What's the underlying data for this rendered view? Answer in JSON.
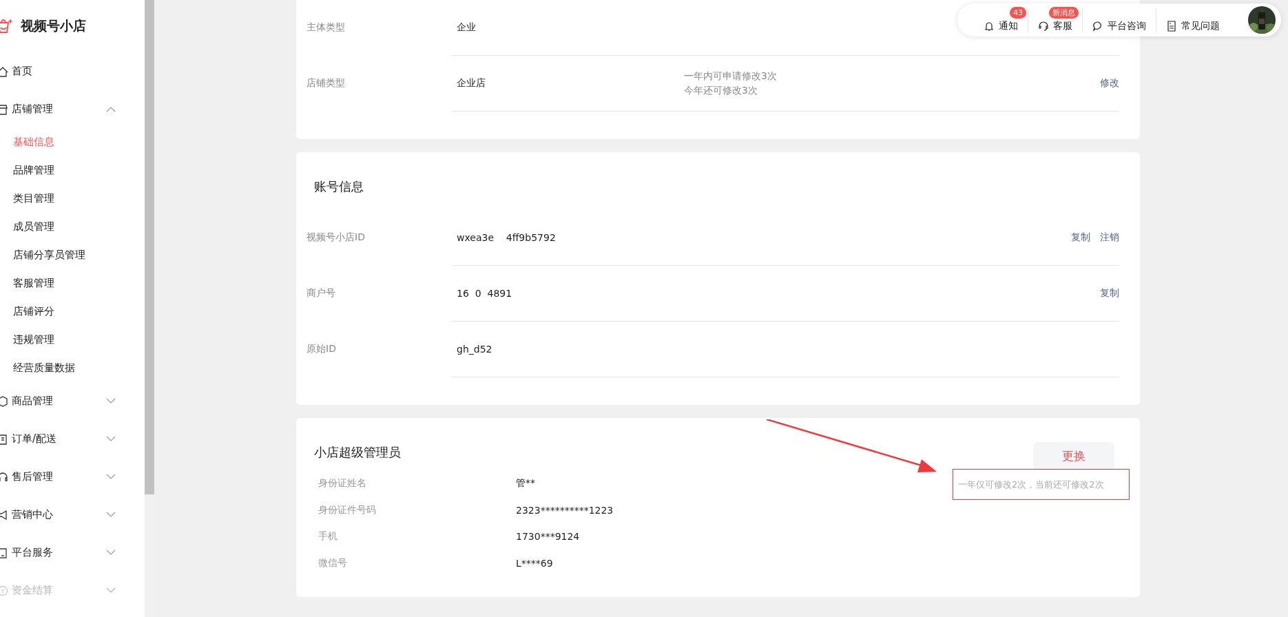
{
  "brand": {
    "name": "视频号小店"
  },
  "nav": [
    {
      "label": "首页",
      "expandable": false
    },
    {
      "label": "店铺管理",
      "expandable": true,
      "expanded": true,
      "children": [
        {
          "label": "基础信息",
          "selected": true
        },
        {
          "label": "品牌管理",
          "selected": false
        },
        {
          "label": "类目管理",
          "selected": false
        },
        {
          "label": "成员管理",
          "selected": false
        },
        {
          "label": "店铺分享员管理",
          "selected": false
        },
        {
          "label": "客服管理",
          "selected": false
        },
        {
          "label": "店铺评分",
          "selected": false
        },
        {
          "label": "违规管理",
          "selected": false
        },
        {
          "label": "经营质量数据",
          "selected": false
        }
      ]
    },
    {
      "label": "商品管理",
      "expandable": true,
      "expanded": false
    },
    {
      "label": "订单/配送",
      "expandable": true,
      "expanded": false
    },
    {
      "label": "售后管理",
      "expandable": true,
      "expanded": false
    },
    {
      "label": "营销中心",
      "expandable": true,
      "expanded": false
    },
    {
      "label": "平台服务",
      "expandable": true,
      "expanded": false
    },
    {
      "label": "资金结算",
      "expandable": true,
      "expanded": false
    }
  ],
  "topbar": {
    "items": [
      {
        "label": "通知",
        "badge": "43"
      },
      {
        "label": "客服",
        "badge": "新消息"
      },
      {
        "label": "平台咨询"
      },
      {
        "label": "常见问题"
      }
    ]
  },
  "cards": [
    {
      "rows": [
        {
          "label": "主体类型",
          "value": "企业"
        },
        {
          "label": "店铺类型",
          "value": "企业店",
          "note": [
            "一年内可申请修改3次",
            "今年还可修改3次"
          ],
          "actions": [
            "修改"
          ]
        }
      ]
    },
    {
      "title": "账号信息",
      "rows": [
        {
          "label": "视频号小店ID",
          "value": "wxea3e    4ff9b5792",
          "actions": [
            "复制",
            "注销"
          ]
        },
        {
          "label": "商户号",
          "value": "16  0  4891",
          "actions": [
            "复制"
          ]
        },
        {
          "label": "原始ID",
          "value": "gh_d52"
        }
      ]
    },
    {
      "title": "小店超级管理员",
      "kind": "compact",
      "button": "更换",
      "note": "一年仅可修改2次，当前还可修改2次",
      "rows": [
        {
          "label": "身份证姓名",
          "value": "管**"
        },
        {
          "label": "身份证件号码",
          "value": "2323**********1223"
        },
        {
          "label": "手机",
          "value": "1730***9124"
        },
        {
          "label": "微信号",
          "value": "L****69"
        }
      ]
    }
  ]
}
